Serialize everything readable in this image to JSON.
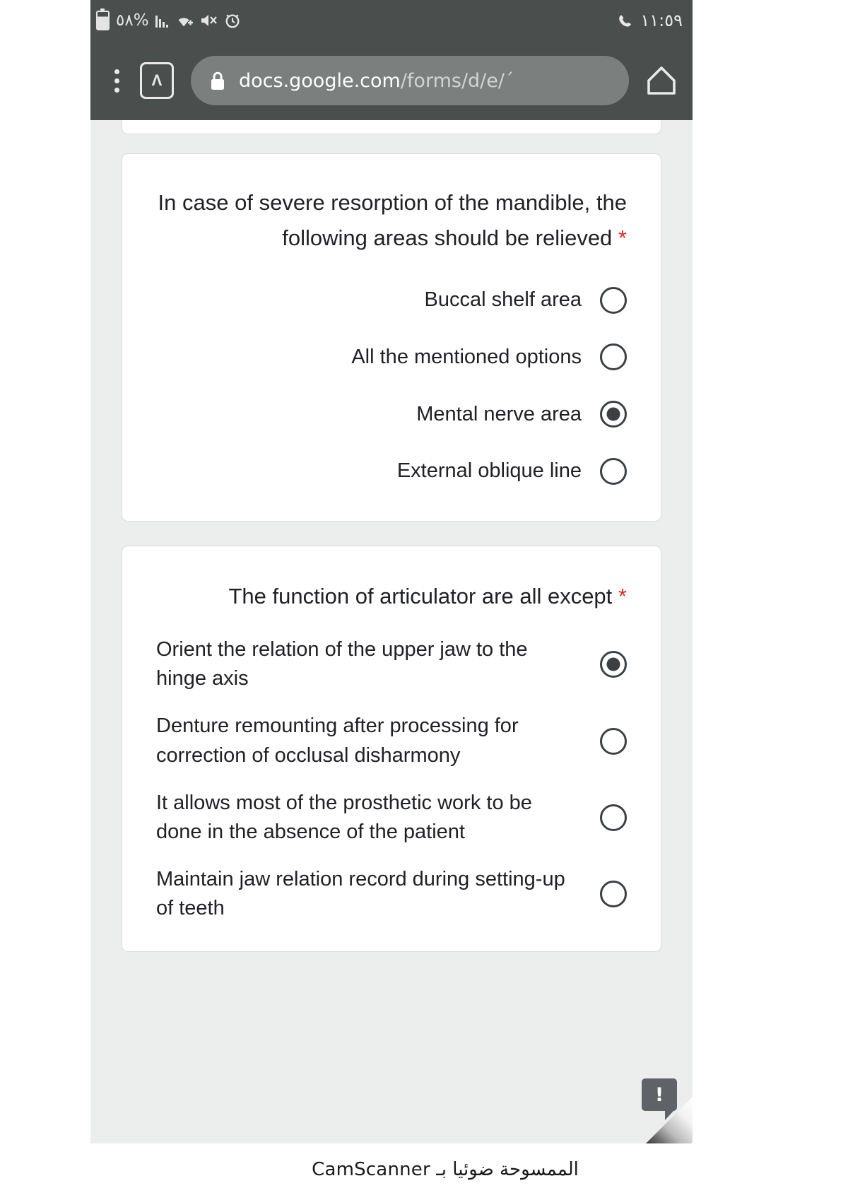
{
  "status_bar": {
    "battery_percent_label": "٥٨%",
    "icons": [
      "battery-icon",
      "signal-bars-icon",
      "wifi-icon",
      "mute-icon",
      "alarm-icon",
      "call-icon"
    ],
    "clock": "١١:٥٩"
  },
  "browser": {
    "menu_icon": "kebab-menu-icon",
    "tab_count_label": "Λ",
    "lock_icon": "lock-icon",
    "url_host": "docs.google.com",
    "url_path": "/forms/d/e/ˊ",
    "home_icon": "home-icon"
  },
  "form": {
    "questions": [
      {
        "id": "q1",
        "required_marker": "*",
        "title": "In case of severe resorption of the mandible, the following areas should be relieved",
        "direction": "rtl",
        "options": [
          {
            "label": "Buccal shelf area",
            "selected": false
          },
          {
            "label": "All the mentioned options",
            "selected": false
          },
          {
            "label": "Mental nerve area",
            "selected": true
          },
          {
            "label": "External oblique line",
            "selected": false
          }
        ]
      },
      {
        "id": "q2",
        "required_marker": "*",
        "title": "The function of articulator are all except",
        "direction": "ltr",
        "options": [
          {
            "label": "Orient the relation of the upper jaw to the hinge axis",
            "selected": true
          },
          {
            "label": "Denture remounting after processing for correction of occlusal disharmony",
            "selected": false
          },
          {
            "label": "It allows most of the prosthetic work to be done in the absence of the patient",
            "selected": false
          },
          {
            "label": "Maintain jaw relation record during setting-up of teeth",
            "selected": false
          }
        ]
      }
    ],
    "feedback_button_label": "!"
  },
  "watermark": {
    "text": "الممسوحة ضوئيا بـ CamScanner"
  },
  "colors": {
    "chrome_bar": "#4a4e4d",
    "url_pill": "#7b7f7e",
    "page_background": "#eceded",
    "card_background": "#ffffff",
    "required_red": "#d93025",
    "radio_dark": "#3c4043",
    "feedback_gray": "#5f6368"
  }
}
